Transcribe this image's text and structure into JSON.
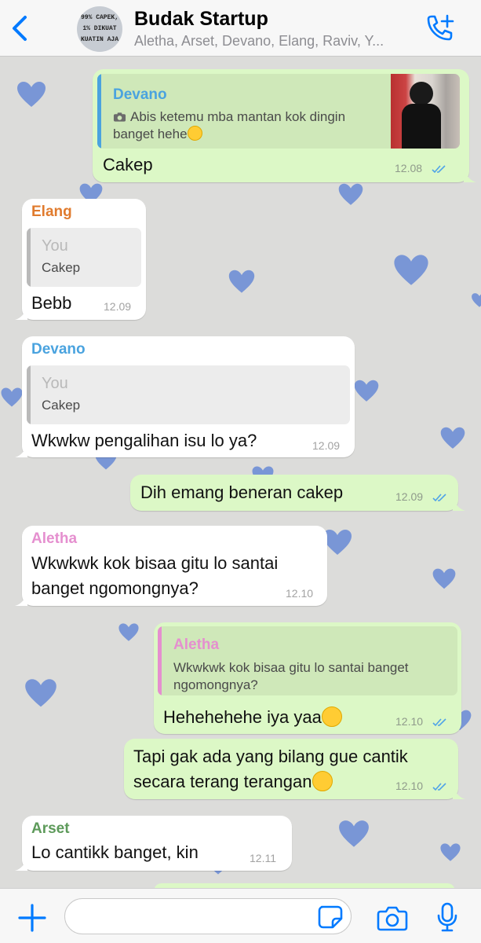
{
  "header": {
    "title": "Budak Startup",
    "members": "Aletha, Arset, Devano, Elang, Raviv, Y...",
    "avatar_text": "99% CAPEK,\n1% DIKUAT\nKUATIN AJA"
  },
  "messages": [
    {
      "direction": "outgoing",
      "quote_name": "Devano",
      "quote_text": "Abis ketemu mba mantan kok dingin banget hehe",
      "quote_icon": "camera-icon",
      "text": "Cakep",
      "time": "12.08"
    },
    {
      "direction": "incoming",
      "sender": "Elang",
      "quote_name": "You",
      "quote_text": "Cakep",
      "text": "Bebb",
      "time": "12.09"
    },
    {
      "direction": "incoming",
      "sender": "Devano",
      "quote_name": "You",
      "quote_text": "Cakep",
      "text": "Wkwkw pengalihan isu lo ya?",
      "time": "12.09"
    },
    {
      "direction": "outgoing",
      "text": "Dih emang beneran cakep",
      "time": "12.09"
    },
    {
      "direction": "incoming",
      "sender": "Aletha",
      "text_line1": "Wkwkwk kok bisaa gitu lo santai",
      "text_line2": "banget ngomongnya?",
      "time": "12.10"
    },
    {
      "direction": "outgoing",
      "quote_name": "Aletha",
      "quote_line1": "Wkwkwk kok bisaa gitu lo santai banget",
      "quote_line2": "ngomongnya?",
      "text": "Hehehehehe iya yaa",
      "time": "12.10"
    },
    {
      "direction": "outgoing",
      "text_line1": "Tapi gak ada yang bilang gue cantik",
      "text_line2": "secara terang terangan",
      "time": "12.10"
    },
    {
      "direction": "incoming",
      "sender": "Arset",
      "text": "Lo cantikk banget, kin",
      "time": "12.11"
    }
  ],
  "colors": {
    "accent": "#007aff",
    "devano": "#4aa3df",
    "elang": "#e07b2e",
    "aletha": "#e58fcf",
    "arset": "#5d9a5a",
    "you": "#b9b9b9",
    "heart": "#6f8fd6"
  },
  "icons": {
    "back": "chevron-left-icon",
    "call": "phone-plus-icon",
    "add": "plus-icon",
    "sticker": "sticker-icon",
    "camera": "camera-icon",
    "mic": "microphone-icon"
  },
  "input": {
    "placeholder": ""
  }
}
